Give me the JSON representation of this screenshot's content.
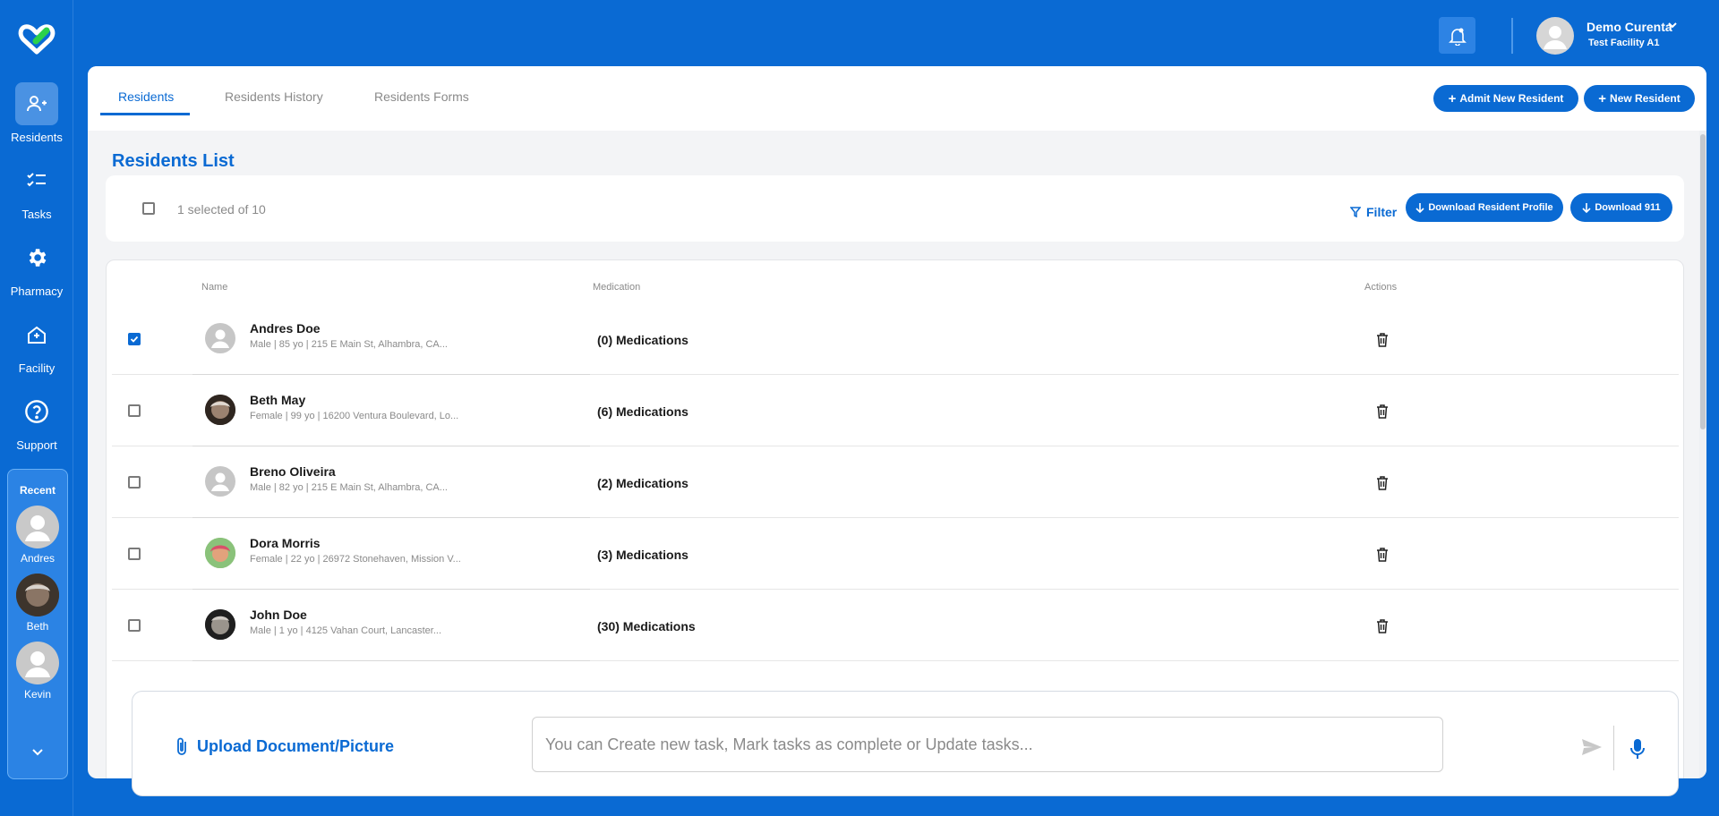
{
  "sidebar": {
    "items": [
      {
        "label": "Residents",
        "icon": "residents-icon",
        "active": true
      },
      {
        "label": "Tasks",
        "icon": "tasks-icon"
      },
      {
        "label": "Pharmacy",
        "icon": "gear-icon"
      },
      {
        "label": "Facility",
        "icon": "facility-icon"
      },
      {
        "label": "Support",
        "icon": "help-icon"
      }
    ],
    "recent": {
      "title": "Recent",
      "items": [
        {
          "name": "Andres"
        },
        {
          "name": "Beth"
        },
        {
          "name": "Kevin"
        }
      ]
    }
  },
  "header": {
    "user_name": "Demo Curenta",
    "facility": "Test Facility A1"
  },
  "tabs": [
    {
      "label": "Residents",
      "active": true
    },
    {
      "label": "Residents History"
    },
    {
      "label": "Residents Forms"
    }
  ],
  "actions": {
    "admit_label": "Admit New Resident",
    "new_label": "New Resident"
  },
  "list": {
    "title": "Residents List",
    "selection": "1 selected of 10",
    "filter_label": "Filter",
    "download_profile_label": "Download Resident Profile",
    "download_911_label": "Download 911",
    "columns": {
      "name": "Name",
      "medication": "Medication",
      "actions": "Actions"
    },
    "rows": [
      {
        "name": "Andres Doe",
        "detail": "Male | 85 yo | 215 E Main St, Alhambra, CA...",
        "medications": "(0) Medications",
        "checked": true,
        "avatar": "placeholder"
      },
      {
        "name": "Beth May",
        "detail": "Female | 99 yo | 16200 Ventura Boulevard, Lo...",
        "medications": "(6) Medications",
        "checked": false,
        "avatar": "photo"
      },
      {
        "name": "Breno Oliveira",
        "detail": "Male | 82 yo | 215 E Main St, Alhambra, CA...",
        "medications": "(2) Medications",
        "checked": false,
        "avatar": "placeholder"
      },
      {
        "name": "Dora Morris",
        "detail": "Female | 22 yo | 26972 Stonehaven, Mission V...",
        "medications": "(3) Medications",
        "checked": false,
        "avatar": "photo"
      },
      {
        "name": "John Doe",
        "detail": "Male | 1 yo | 4125 Vahan Court, Lancaster...",
        "medications": "(30) Medications",
        "checked": false,
        "avatar": "photo"
      }
    ]
  },
  "composer": {
    "upload_label": "Upload Document/Picture",
    "placeholder": "You can Create new task, Mark tasks as complete or Update tasks..."
  },
  "colors": {
    "primary": "#0a6ad3",
    "background": "#f3f4f6"
  }
}
